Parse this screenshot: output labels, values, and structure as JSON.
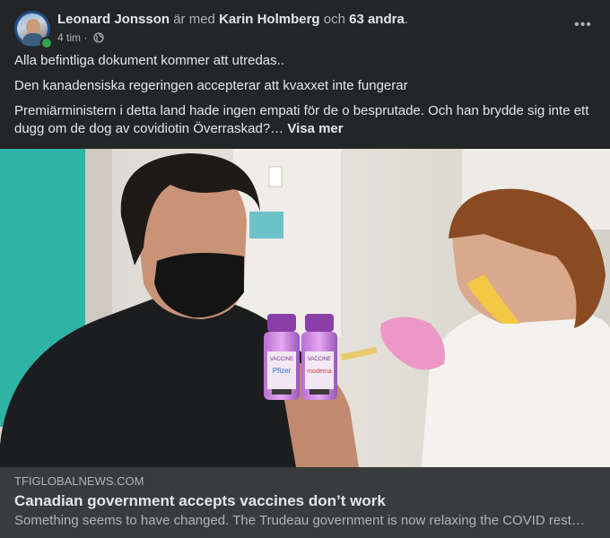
{
  "post": {
    "author": "Leonard Jonsson",
    "with_text": "är med",
    "tagged_name": "Karin Holmberg",
    "and_text": "och",
    "others": "63 andra",
    "period": ".",
    "time": "4 tim",
    "separator": "·",
    "privacy_icon": "globe-icon",
    "more_icon": "more-options-icon",
    "more_glyph": "•••",
    "paragraphs": [
      "Alla befintliga dokument kommer att utredas..",
      "Den kanadensiska regeringen accepterar att kvaxxet inte fungerar",
      "Premiärministern i detta land hade ingen empati för de o besprutade. Och han brydde sig inte ett dugg om de dog av covidiotin Överraskad?…"
    ],
    "see_more": "Visa mer"
  },
  "link_preview": {
    "domain": "TFIGLOBALNEWS.COM",
    "title": "Canadian government accepts vaccines don’t work",
    "description": "Something seems to have changed. The Trudeau government is now relaxing the COVID restrictions",
    "vial_labels": [
      "VACCINE",
      "VACCINE"
    ],
    "vial_brands": [
      "Pfizer",
      "moderna"
    ]
  },
  "colors": {
    "background": "#242526",
    "caption_background": "#3a3b3c",
    "primary_text": "#e4e6eb",
    "secondary_text": "#b0b3b8",
    "online": "#31a24c"
  }
}
